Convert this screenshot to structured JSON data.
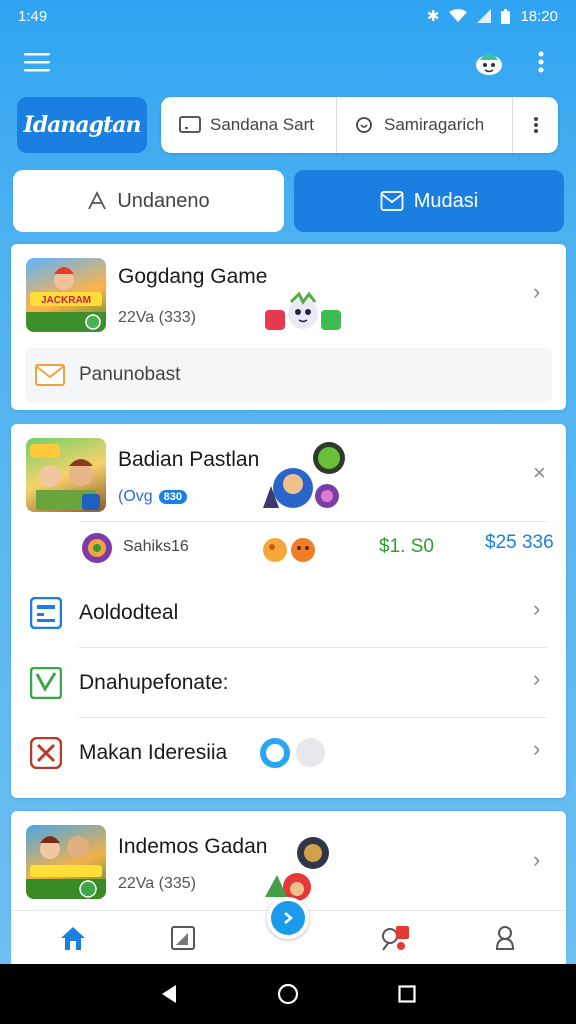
{
  "status_bar": {
    "time_left": "1:49",
    "time_right": "18:20"
  },
  "header": {
    "logo_text": "Idanagtan",
    "search_chip_1": "Sandana Sart",
    "search_chip_2": "Samiragarich"
  },
  "tabs": [
    {
      "label": "Undaneno",
      "active": false
    },
    {
      "label": "Mudasi",
      "active": true
    }
  ],
  "card1": {
    "title": "Gogdang Game",
    "subtitle": "22Va (333)",
    "notice": "Panunobast"
  },
  "card2": {
    "title": "Badian Pastlan",
    "subtitle": "(Ovg",
    "badge": "830",
    "player_name": "Sahiks16",
    "price_1": "$1. S0",
    "price_2": "$25 336",
    "menu": [
      {
        "label": "Aoldodteal",
        "icon": "calendar-icon"
      },
      {
        "label": "Dnahupefonate:",
        "icon": "check-icon"
      },
      {
        "label": "Makan Ideresiia",
        "icon": "close-icon"
      }
    ]
  },
  "card3": {
    "title": "Indemos Gadan",
    "subtitle": "22Va (335)"
  },
  "bottom_nav": [
    {
      "icon": "home-icon",
      "active": true
    },
    {
      "icon": "square-icon"
    },
    {
      "icon": "arrow-right-icon"
    },
    {
      "icon": "notifications-icon"
    },
    {
      "icon": "profile-icon"
    }
  ],
  "colors": {
    "primary": "#1a7fe0",
    "background_top": "#2fa4f2",
    "green_price": "#2e9b3a",
    "blue_price": "#1a7fe0"
  }
}
